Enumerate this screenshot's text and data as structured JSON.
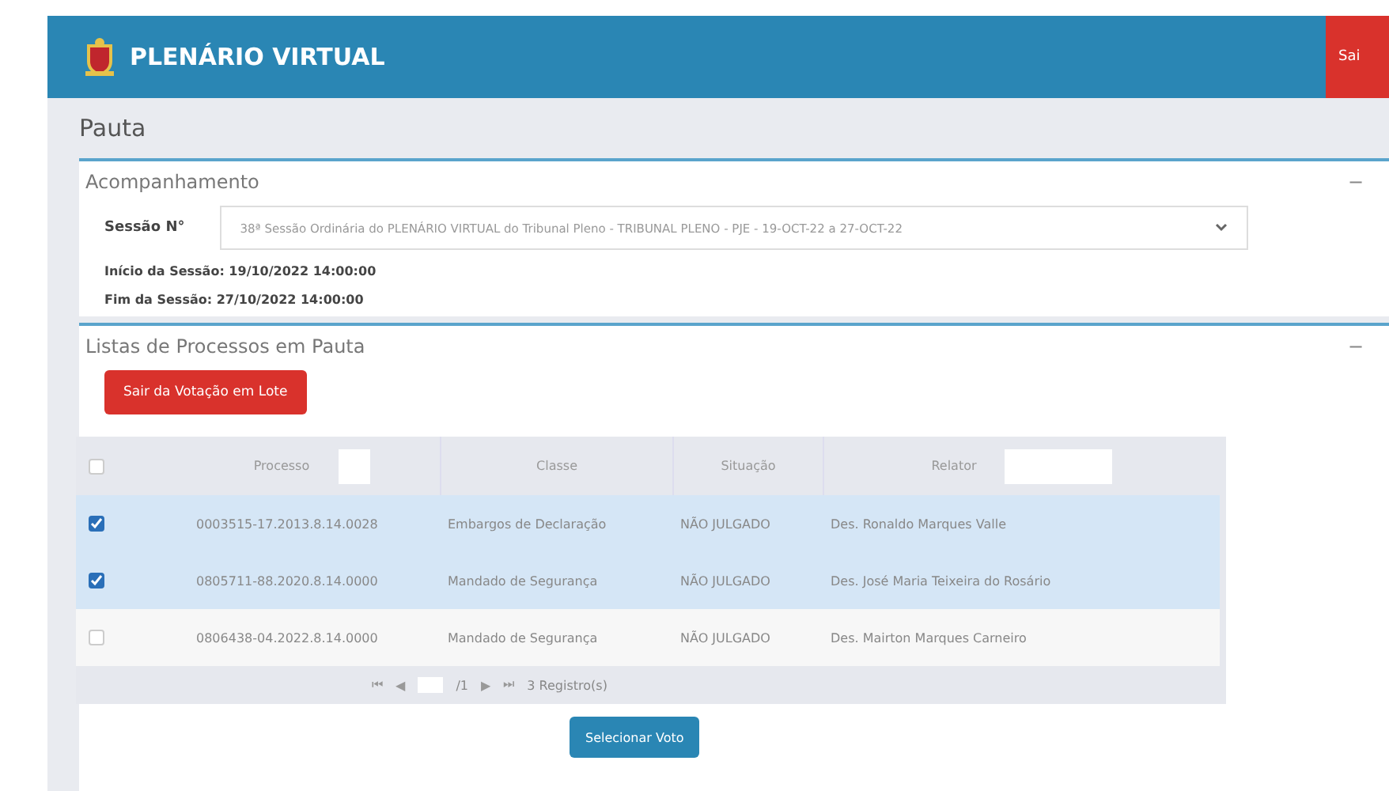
{
  "header": {
    "title": "PLENÁRIO VIRTUAL",
    "exit_button": "Sai"
  },
  "breadcrumb": "Pauta",
  "session_panel": {
    "title": "Acompanhamento",
    "collapse": "−",
    "session_label": "Sessão N°",
    "session_value": "38ª Sessão Ordinária do PLENÁRIO VIRTUAL do Tribunal Pleno - TRIBUNAL PLENO - PJE - 19-OCT-22 a 27-OCT-22",
    "start": "Início da Sessão: 19/10/2022 14:00:00",
    "end": "Fim da Sessão: 27/10/2022 14:00:00"
  },
  "list_panel": {
    "title": "Listas de Processos em Pauta",
    "collapse": "−",
    "batch_button": "Sair da Votação em Lote"
  },
  "table": {
    "select_all": false,
    "columns": [
      "Processo",
      "Classe",
      "Situação",
      "Relator"
    ],
    "rows": [
      {
        "checked": true,
        "processo": "0003515-17.2013.8.14.0028",
        "classe": "Embargos de Declaração",
        "situacao": "NÃO JULGADO",
        "relator": "Des. Ronaldo Marques Valle"
      },
      {
        "checked": true,
        "processo": "0805711-88.2020.8.14.0000",
        "classe": "Mandado de Segurança",
        "situacao": "NÃO JULGADO",
        "relator": "Des. José Maria Teixeira do Rosário"
      },
      {
        "checked": false,
        "processo": "0806438-04.2022.8.14.0000",
        "classe": "Mandado de Segurança",
        "situacao": "NÃO JULGADO",
        "relator": "Des. Mairton Marques Carneiro"
      }
    ],
    "pager": {
      "first": "⏮",
      "prev": "◀",
      "total": "/1",
      "next": "▶",
      "last": "⏭",
      "count": "3 Registro(s)"
    }
  },
  "select_button": "Selecionar Voto"
}
